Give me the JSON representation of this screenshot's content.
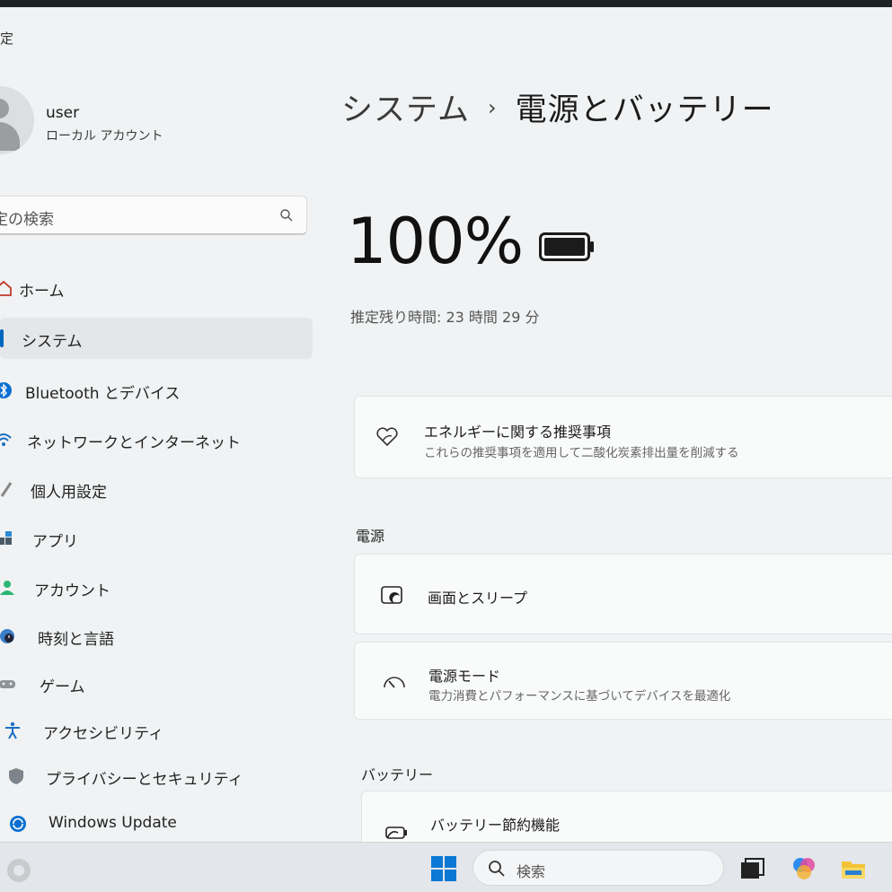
{
  "window": {
    "title": "設定"
  },
  "user": {
    "name": "user",
    "account_type": "ローカル アカウント"
  },
  "search": {
    "placeholder": "設定の検索"
  },
  "sidebar": {
    "items": [
      {
        "label": "ホーム",
        "icon": "home-icon"
      },
      {
        "label": "システム",
        "icon": "system-icon",
        "active": true
      },
      {
        "label": "Bluetooth とデバイス",
        "icon": "bluetooth-icon"
      },
      {
        "label": "ネットワークとインターネット",
        "icon": "network-icon"
      },
      {
        "label": "個人用設定",
        "icon": "brush-icon"
      },
      {
        "label": "アプリ",
        "icon": "apps-icon"
      },
      {
        "label": "アカウント",
        "icon": "account-icon"
      },
      {
        "label": "時刻と言語",
        "icon": "globe-clock-icon"
      },
      {
        "label": "ゲーム",
        "icon": "gamepad-icon"
      },
      {
        "label": "アクセシビリティ",
        "icon": "accessibility-icon"
      },
      {
        "label": "プライバシーとセキュリティ",
        "icon": "shield-icon"
      },
      {
        "label": "Windows Update",
        "icon": "update-icon"
      }
    ]
  },
  "breadcrumb": {
    "parent": "システム",
    "separator": "›",
    "current": "電源とバッテリー"
  },
  "battery": {
    "percent": "100%",
    "remaining": "推定残り時間: 23 時間 29 分",
    "level": 1.0
  },
  "recommendations": {
    "title": "エネルギーに関する推奨事項",
    "description": "これらの推奨事項を適用して二酸化炭素排出量を削減する"
  },
  "power_section": {
    "title": "電源",
    "items": [
      {
        "title": "画面とスリープ",
        "description": ""
      },
      {
        "title": "電源モード",
        "description": "電力消費とパフォーマンスに基づいてデバイスを最適化"
      }
    ]
  },
  "battery_section": {
    "title": "バッテリー",
    "items": [
      {
        "title": "バッテリー節約機能"
      }
    ]
  },
  "taskbar": {
    "search_placeholder": "検索"
  },
  "colors": {
    "accent": "#0067c0",
    "background": "#f0f2f3"
  }
}
